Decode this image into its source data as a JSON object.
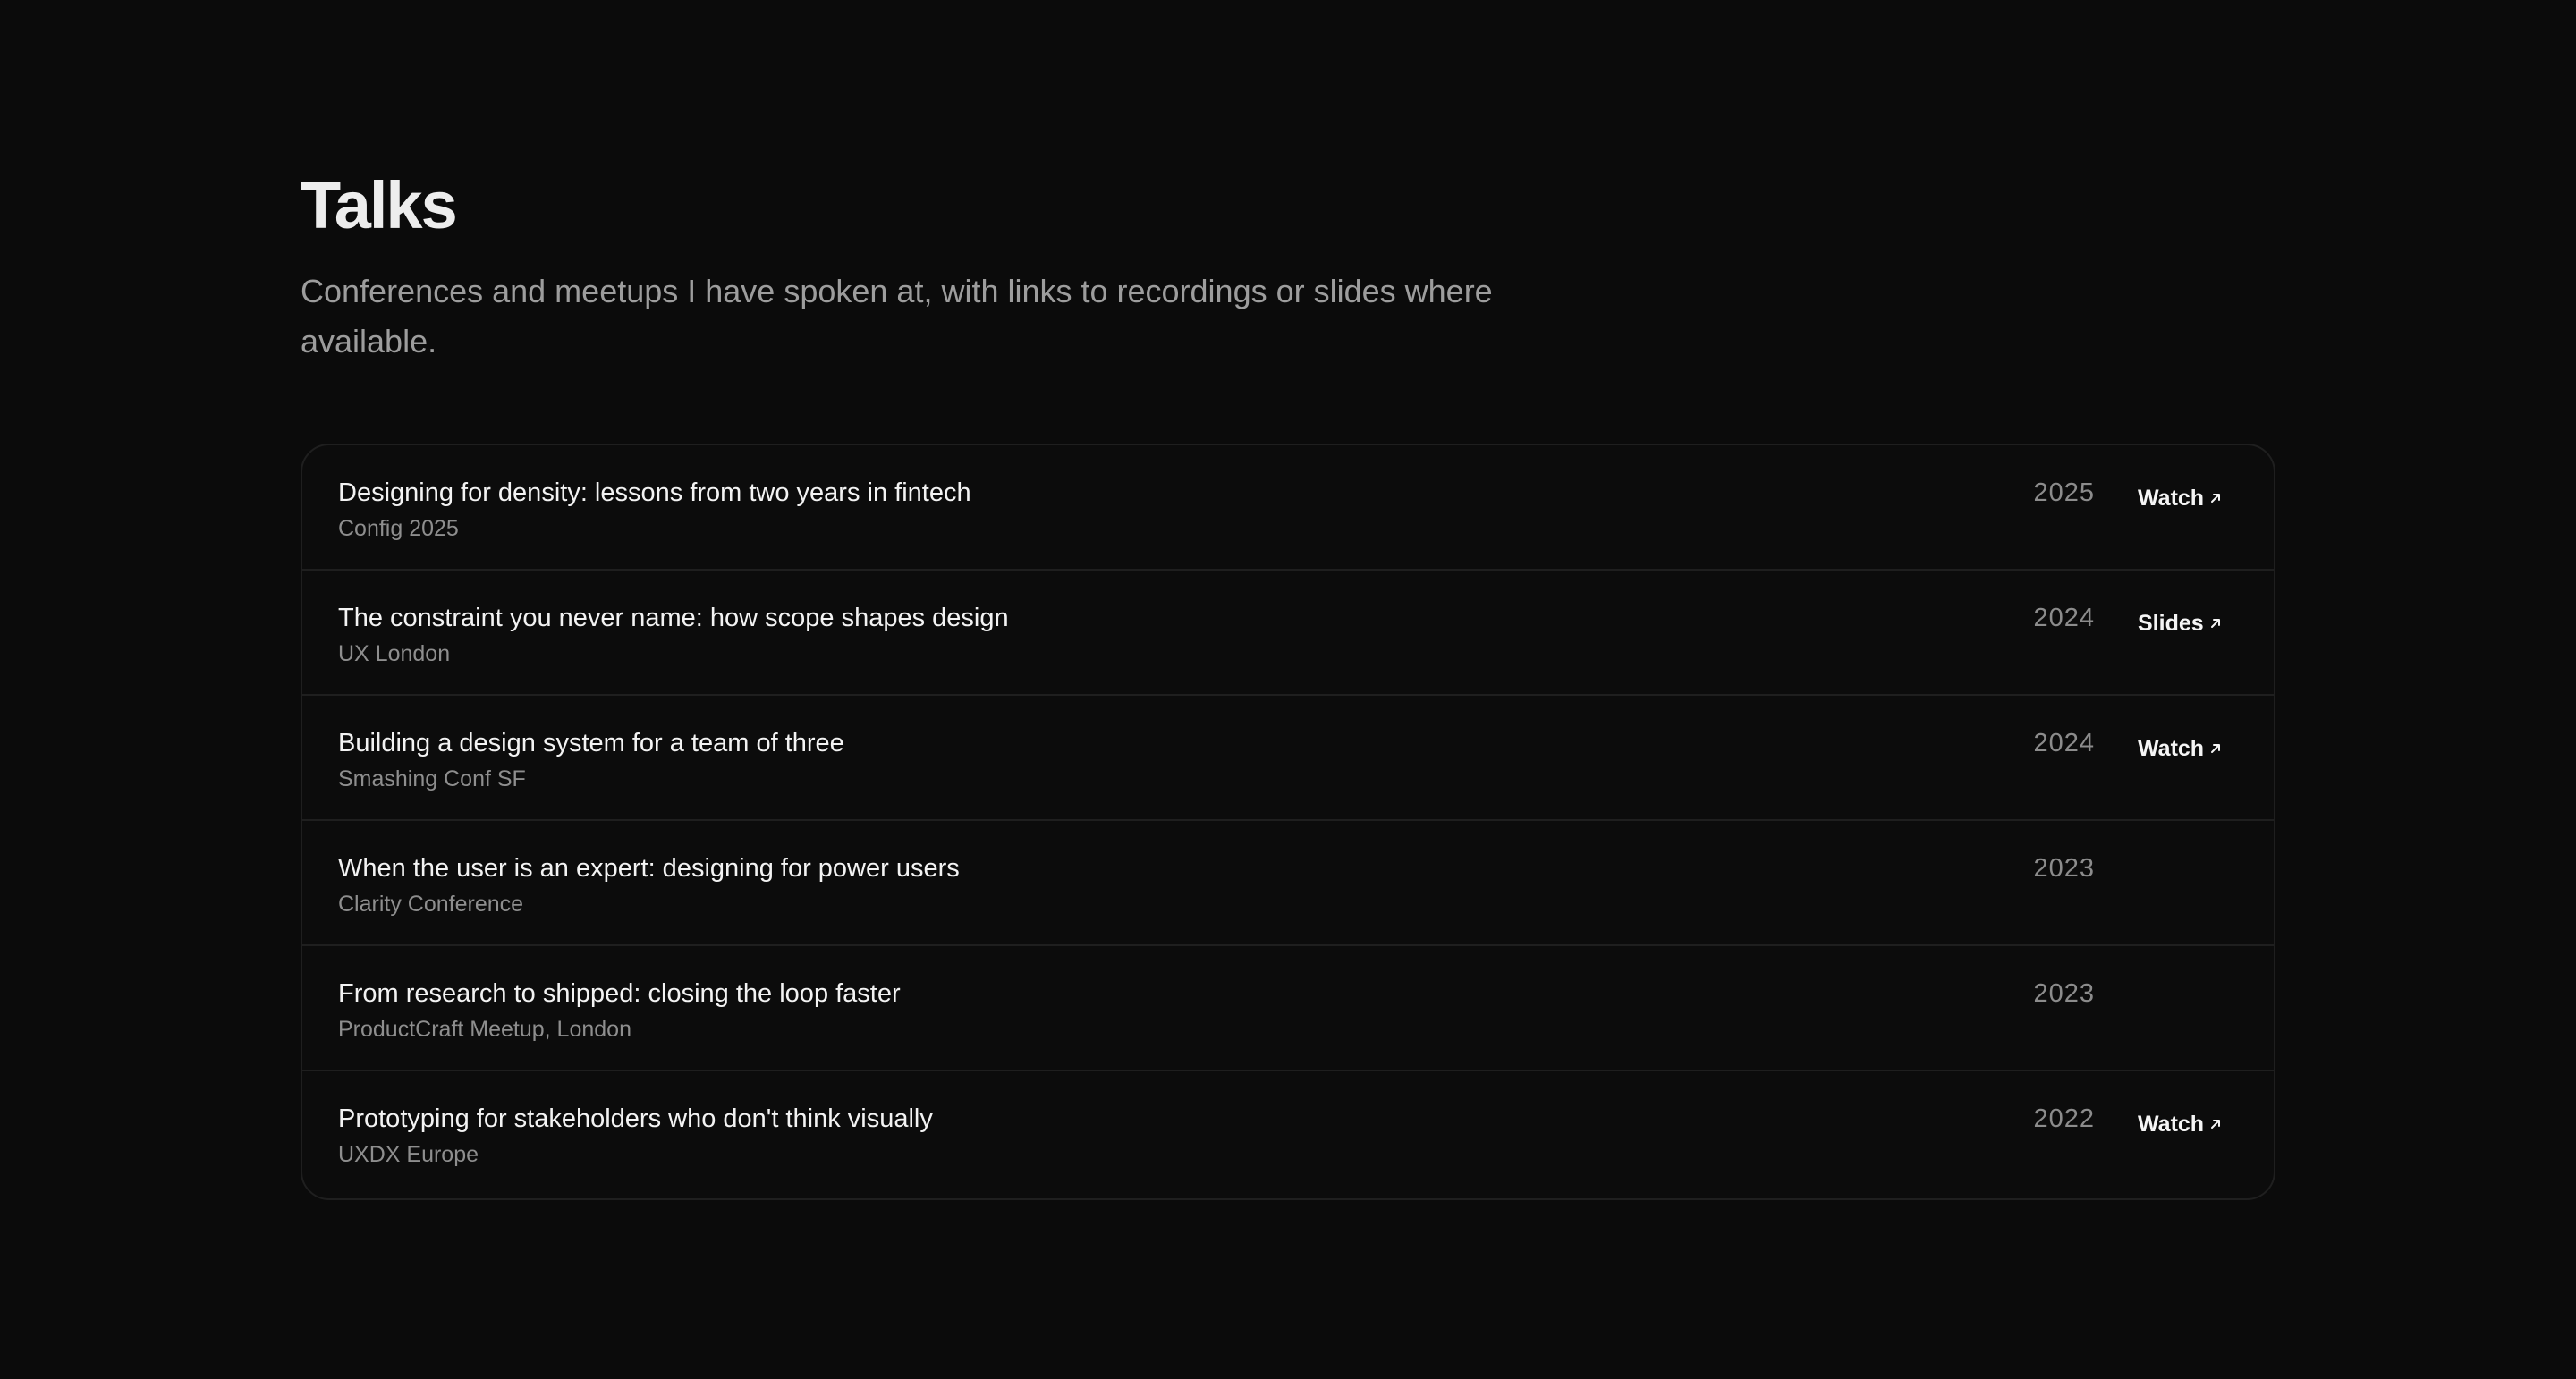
{
  "header": {
    "title": "Talks",
    "subtitle": "Conferences and meetups I have spoken at, with links to recordings or slides where available."
  },
  "talks": [
    {
      "title": "Designing for density: lessons from two years in fintech",
      "venue": "Config 2025",
      "year": "2025",
      "link_label": "Watch",
      "link_icon": "arrow-up-right-icon"
    },
    {
      "title": "The constraint you never name: how scope shapes design",
      "venue": "UX London",
      "year": "2024",
      "link_label": "Slides",
      "link_icon": "arrow-up-right-icon"
    },
    {
      "title": "Building a design system for a team of three",
      "venue": "Smashing Conf SF",
      "year": "2024",
      "link_label": "Watch",
      "link_icon": "arrow-up-right-icon"
    },
    {
      "title": "When the user is an expert: designing for power users",
      "venue": "Clarity Conference",
      "year": "2023",
      "link_label": null
    },
    {
      "title": "From research to shipped: closing the loop faster",
      "venue": "ProductCraft Meetup, London",
      "year": "2023",
      "link_label": null
    },
    {
      "title": "Prototyping for stakeholders who don't think visually",
      "venue": "UXDX Europe",
      "year": "2022",
      "link_label": "Watch",
      "link_icon": "arrow-up-right-icon"
    }
  ],
  "colors": {
    "background": "#0b0b0b",
    "title": "#ededed",
    "muted": "#9d9d9d",
    "border": "#1f1f1f",
    "link": "#f5f5f5"
  }
}
